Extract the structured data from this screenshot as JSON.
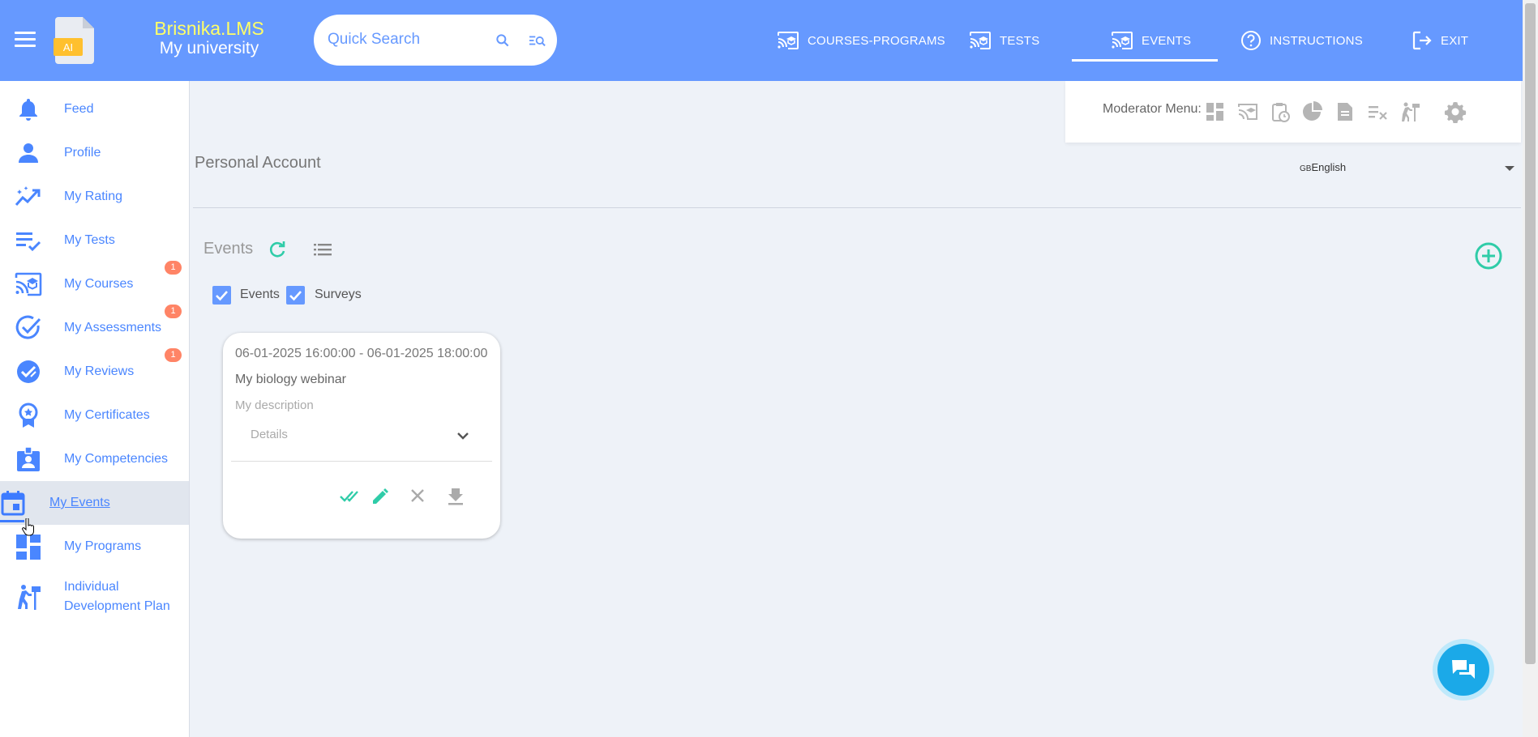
{
  "brand": {
    "name": "Brisnika.LMS",
    "subtitle": "My university",
    "logo_text": "AI"
  },
  "search": {
    "placeholder": "Quick Search"
  },
  "nav": {
    "items": [
      {
        "label": "COURSES-PROGRAMS",
        "icon": "cast-education-icon"
      },
      {
        "label": "TESTS",
        "icon": "cast-education-icon"
      },
      {
        "label": "EVENTS",
        "icon": "cast-education-icon",
        "active": true
      },
      {
        "label": "INSTRUCTIONS",
        "icon": "help-circle-icon"
      },
      {
        "label": "EXIT",
        "icon": "logout-icon"
      }
    ]
  },
  "sidebar": {
    "items": [
      {
        "label": "Feed",
        "icon": "bell-icon"
      },
      {
        "label": "Profile",
        "icon": "person-icon"
      },
      {
        "label": "My Rating",
        "icon": "trending-up-icon"
      },
      {
        "label": "My Tests",
        "icon": "checklist-icon"
      },
      {
        "label": "My Courses",
        "icon": "cast-education-icon",
        "badge": "1"
      },
      {
        "label": "My Assessments",
        "icon": "check-circle-icon",
        "badge": "1"
      },
      {
        "label": "My Reviews",
        "icon": "rate-review-icon",
        "badge": "1"
      },
      {
        "label": "My Certificates",
        "icon": "award-icon"
      },
      {
        "label": "My Competencies",
        "icon": "badge-id-icon"
      },
      {
        "label": "My Events",
        "icon": "calendar-icon",
        "active": true
      },
      {
        "label": "My Programs",
        "icon": "dashboard-icon"
      },
      {
        "label": "Individual Development Plan",
        "icon": "hiking-icon"
      }
    ]
  },
  "moderator": {
    "label": "Moderator Menu:"
  },
  "page": {
    "heading": "Personal Account"
  },
  "language": {
    "flag": "GB",
    "label": "English"
  },
  "events_section": {
    "title": "Events",
    "filters": [
      {
        "label": "Events",
        "checked": true
      },
      {
        "label": "Surveys",
        "checked": true
      }
    ]
  },
  "event_card": {
    "date_range": "06-01-2025 16:00:00 - 06-01-2025 18:00:00",
    "title": "My biology webinar",
    "description": "My description",
    "details_label": "Details"
  },
  "colors": {
    "topbar": "#6699ff",
    "brand_yellow": "#ffff66",
    "link_blue": "#4a86ff",
    "teal": "#2fcca8",
    "badge": "#ff8466",
    "chat": "#1ba9e8"
  }
}
